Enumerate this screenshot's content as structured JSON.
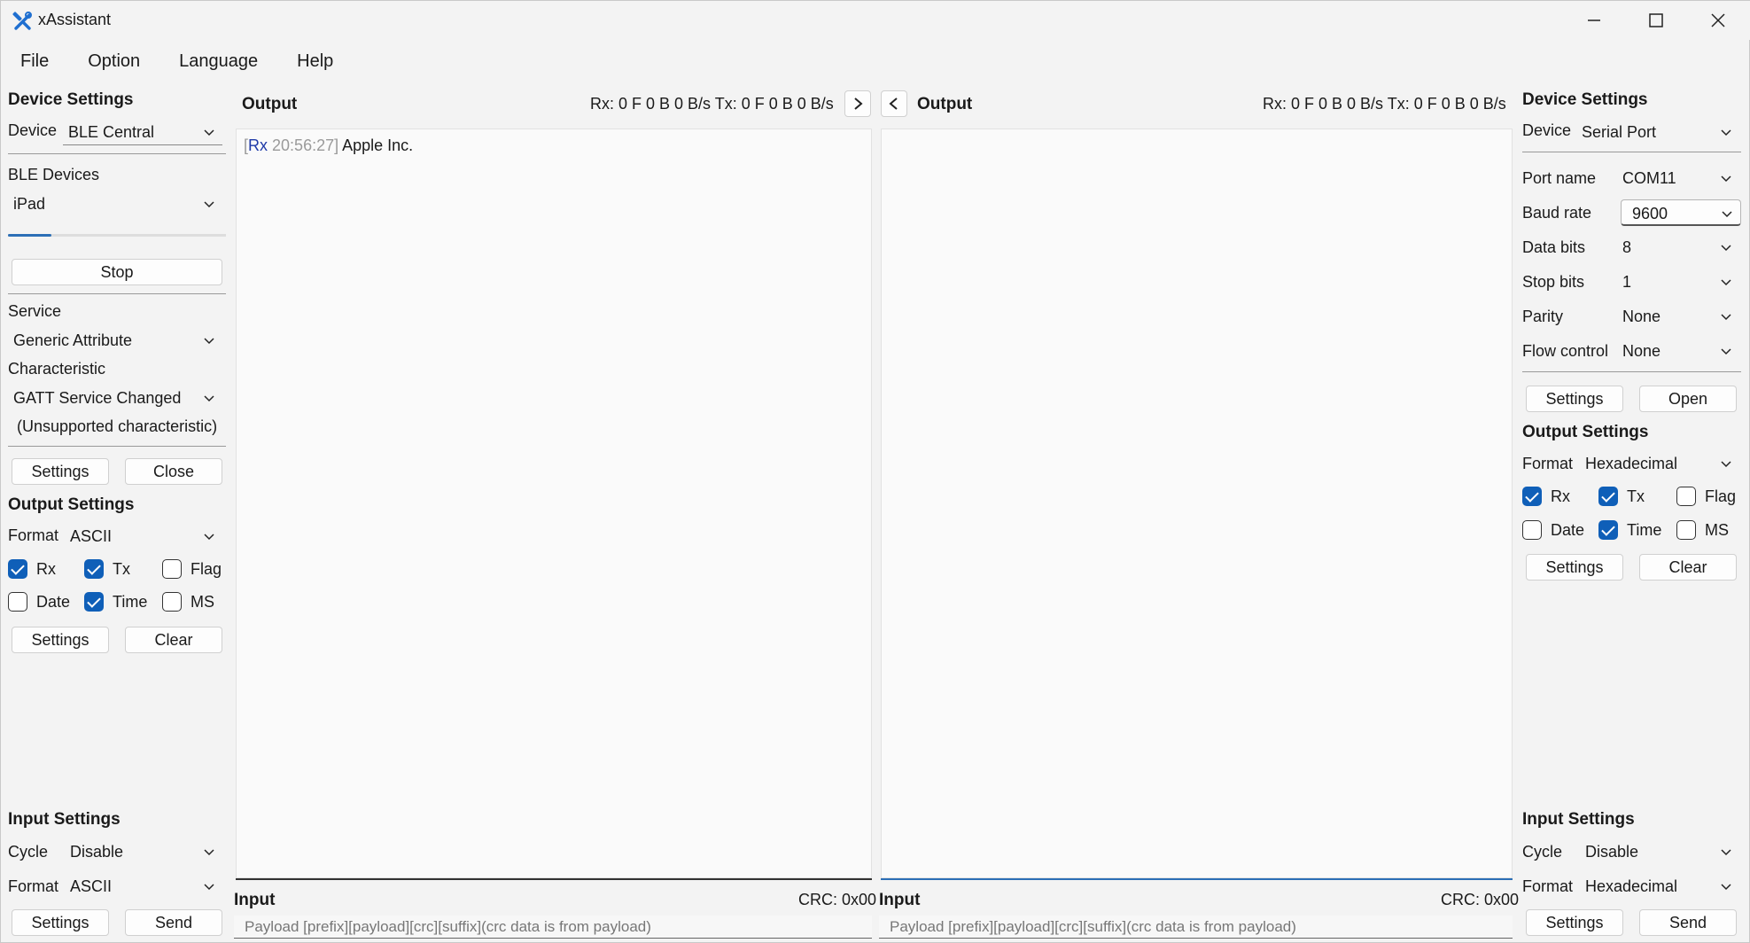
{
  "window": {
    "title": "xAssistant"
  },
  "menu": [
    "File",
    "Option",
    "Language",
    "Help"
  ],
  "left": {
    "device_settings_title": "Device Settings",
    "device_label": "Device",
    "device_value": "BLE Central",
    "ble_devices_label": "BLE Devices",
    "ble_device_value": "iPad",
    "scan_progress_percent": 20,
    "stop_button": "Stop",
    "service_label": "Service",
    "service_value": "Generic Attribute",
    "characteristic_label": "Characteristic",
    "characteristic_value": "GATT Service Changed",
    "unsupported_note": "(Unsupported characteristic)",
    "settings_button": "Settings",
    "close_button": "Close",
    "output_settings_title": "Output Settings",
    "format_label": "Format",
    "format_value": "ASCII",
    "checks": {
      "rx": "Rx",
      "tx": "Tx",
      "flag": "Flag",
      "date": "Date",
      "time": "Time",
      "ms": "MS"
    },
    "checked": {
      "rx": true,
      "tx": true,
      "flag": false,
      "date": false,
      "time": true,
      "ms": false
    },
    "output_settings_button": "Settings",
    "clear_button": "Clear",
    "input_settings_title": "Input Settings",
    "cycle_label": "Cycle",
    "cycle_value": "Disable",
    "input_format_label": "Format",
    "input_format_value": "ASCII",
    "input_settings_button": "Settings",
    "send_button": "Send"
  },
  "center_left": {
    "output_title": "Output",
    "stats": "Rx: 0 F 0 B 0 B/s Tx: 0 F 0 B 0 B/s",
    "log": {
      "tag": "Rx",
      "time": "20:56:27]",
      "open_bracket": "[",
      "text": "Apple Inc."
    },
    "input_title": "Input",
    "crc": "CRC: 0x00",
    "payload_placeholder": "Payload [prefix][payload][crc][suffix](crc data is from payload)"
  },
  "center_right": {
    "output_title": "Output",
    "stats": "Rx: 0 F 0 B 0 B/s Tx: 0 F 0 B 0 B/s",
    "input_title": "Input",
    "crc": "CRC: 0x00",
    "payload_placeholder": "Payload [prefix][payload][crc][suffix](crc data is from payload)"
  },
  "right": {
    "device_settings_title": "Device Settings",
    "device_label": "Device",
    "device_value": "Serial Port",
    "port_name_label": "Port name",
    "port_name_value": "COM11",
    "baud_rate_label": "Baud rate",
    "baud_rate_value": "9600",
    "data_bits_label": "Data bits",
    "data_bits_value": "8",
    "stop_bits_label": "Stop bits",
    "stop_bits_value": "1",
    "parity_label": "Parity",
    "parity_value": "None",
    "flow_control_label": "Flow control",
    "flow_control_value": "None",
    "settings_button": "Settings",
    "open_button": "Open",
    "output_settings_title": "Output Settings",
    "format_label": "Format",
    "format_value": "Hexadecimal",
    "checks": {
      "rx": "Rx",
      "tx": "Tx",
      "flag": "Flag",
      "date": "Date",
      "time": "Time",
      "ms": "MS"
    },
    "checked": {
      "rx": true,
      "tx": true,
      "flag": false,
      "date": false,
      "time": true,
      "ms": false
    },
    "output_settings_button": "Settings",
    "clear_button": "Clear",
    "input_settings_title": "Input Settings",
    "cycle_label": "Cycle",
    "cycle_value": "Disable",
    "input_format_label": "Format",
    "input_format_value": "Hexadecimal",
    "input_settings_button": "Settings",
    "send_button": "Send"
  },
  "colors": {
    "accent": "#0f5fb8",
    "rx_tag": "#1f3aa8",
    "timestamp": "#9a9a9a"
  },
  "icons": {
    "app": "tools-icon",
    "minimize": "minimize-icon",
    "maximize": "maximize-icon",
    "close": "close-icon",
    "nav_right": "chevron-right-icon",
    "nav_left": "chevron-left-icon",
    "dropdown": "chevron-down-icon"
  }
}
